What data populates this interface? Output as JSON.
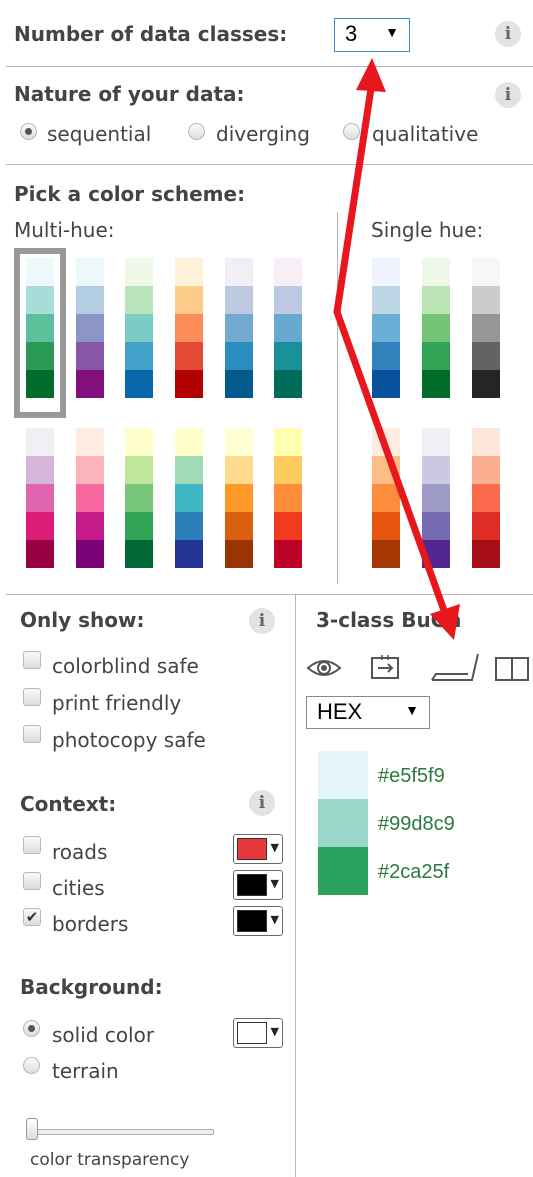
{
  "classes": {
    "label": "Number of data classes:",
    "value": "3",
    "arrow": "▼"
  },
  "nature": {
    "label": "Nature of your data:",
    "options": [
      {
        "label": "sequential",
        "selected": true
      },
      {
        "label": "diverging",
        "selected": false
      },
      {
        "label": "qualitative",
        "selected": false
      }
    ]
  },
  "scheme": {
    "label": "Pick a color scheme:",
    "multi_label": "Multi-hue:",
    "single_label": "Single hue:"
  },
  "multi_row1": [
    [
      "#edf8fb",
      "#a8dcd8",
      "#5cc09a",
      "#2a9b57",
      "#006d2c"
    ],
    [
      "#edf8fb",
      "#b3cde3",
      "#8c96c6",
      "#8856a7",
      "#810f7c"
    ],
    [
      "#f0f9e8",
      "#bae4bc",
      "#7bccc4",
      "#43a2ca",
      "#0868ac"
    ],
    [
      "#fef0d9",
      "#fdcc8a",
      "#fc8d59",
      "#e34a33",
      "#b30000"
    ],
    [
      "#f1eef6",
      "#bdc9e1",
      "#74a9cf",
      "#2b8cbe",
      "#045a8d"
    ],
    [
      "#f6eff7",
      "#bdc9e1",
      "#67a9cf",
      "#1c9099",
      "#016c59"
    ]
  ],
  "multi_row2": [
    [
      "#f1eef6",
      "#d7b5d8",
      "#df65b0",
      "#dd1c77",
      "#980043"
    ],
    [
      "#feebe2",
      "#fbb4b9",
      "#f768a1",
      "#c51b8a",
      "#7a0177"
    ],
    [
      "#ffffcc",
      "#c2e699",
      "#78c679",
      "#31a354",
      "#006837"
    ],
    [
      "#ffffcc",
      "#a1dab4",
      "#41b6c4",
      "#2c7fb8",
      "#253494"
    ],
    [
      "#ffffd4",
      "#fed98e",
      "#fe9929",
      "#d95f0e",
      "#993404"
    ],
    [
      "#ffffb2",
      "#fecc5c",
      "#fd8d3c",
      "#f03b20",
      "#bd0026"
    ]
  ],
  "single_row1": [
    [
      "#eff3ff",
      "#bdd7e7",
      "#6baed6",
      "#3182bd",
      "#08519c"
    ],
    [
      "#edf8e9",
      "#bae4b3",
      "#74c476",
      "#31a354",
      "#006d2c"
    ],
    [
      "#f7f7f7",
      "#cccccc",
      "#969696",
      "#636363",
      "#252525"
    ]
  ],
  "single_row2": [
    [
      "#feedde",
      "#fdbe85",
      "#fd8d3c",
      "#e6550d",
      "#a63603"
    ],
    [
      "#f2f0f7",
      "#cbc9e2",
      "#9e9ac8",
      "#756bb1",
      "#54278f"
    ],
    [
      "#fee5d9",
      "#fcae91",
      "#fb6a4a",
      "#de2d26",
      "#a50f15"
    ]
  ],
  "only_show": {
    "label": "Only show:",
    "options": [
      {
        "label": "colorblind safe",
        "checked": false
      },
      {
        "label": "print friendly",
        "checked": false
      },
      {
        "label": "photocopy safe",
        "checked": false
      }
    ]
  },
  "context": {
    "label": "Context:",
    "options": [
      {
        "label": "roads",
        "checked": false,
        "color": "#e8383c"
      },
      {
        "label": "cities",
        "checked": false,
        "color": "#000000"
      },
      {
        "label": "borders",
        "checked": true,
        "color": "#000000"
      }
    ]
  },
  "background": {
    "label": "Background:",
    "options": [
      {
        "label": "solid color",
        "selected": true
      },
      {
        "label": "terrain",
        "selected": false
      }
    ],
    "color": "#ffffff"
  },
  "transparency": {
    "label": "color transparency",
    "value": 0
  },
  "result": {
    "title": "3-class BuGn",
    "format": "HEX",
    "format_arrow": "▼",
    "colors": [
      {
        "hex": "#e5f5f9"
      },
      {
        "hex": "#99d8c9"
      },
      {
        "hex": "#2ca25f"
      }
    ]
  },
  "icons": [
    "eye-icon",
    "export-icon",
    "map-layer-icon",
    "book-icon"
  ],
  "colors": {
    "arrow": "#e8161d",
    "divider": "#b5b5b5",
    "hex_text": "#2b7a3d"
  }
}
